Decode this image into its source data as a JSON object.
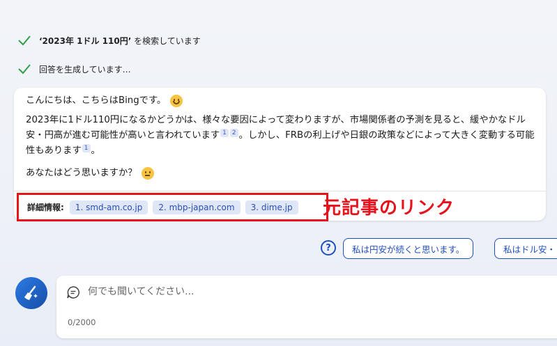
{
  "status": {
    "search_query": "‘2023年 1ドル 110円’",
    "search_suffix": " を検索しています",
    "generating": "回答を生成しています…"
  },
  "response": {
    "greeting": "こんにちは、こちらはBingです。",
    "paragraph_a": "2023年に1ドル110円になるかどうかは、様々な要因によって変わりますが、市場関係者の予測を見ると、緩やかなドル安・円高が進む可能性が高いと言われています",
    "cite_1": "1",
    "cite_2": "2",
    "paragraph_b": "。しかし、FRBの利上げや日銀の政策などによって大きく変動する可能性もあります",
    "cite_3": "1",
    "paragraph_end": "。",
    "question": "あなたはどう思いますか？"
  },
  "sources": {
    "label": "詳細情報:",
    "links": [
      "1. smd-am.co.jp",
      "2. mbp-japan.com",
      "3. dime.jp"
    ]
  },
  "annotation": "元記事のリンク",
  "suggestions": {
    "help_symbol": "?",
    "items": [
      "私は円安が続くと思います。",
      "私はドル安・"
    ]
  },
  "input": {
    "placeholder": "何でも聞いてください...",
    "counter": "0/2000"
  },
  "colors": {
    "accent": "#1f4fbf",
    "highlight_red": "#e4131c",
    "check_green": "#2ea043"
  },
  "icons": [
    "check-icon",
    "smile-emoji-icon",
    "thinking-emoji-icon",
    "help-icon",
    "broom-icon",
    "chat-bubble-icon"
  ]
}
